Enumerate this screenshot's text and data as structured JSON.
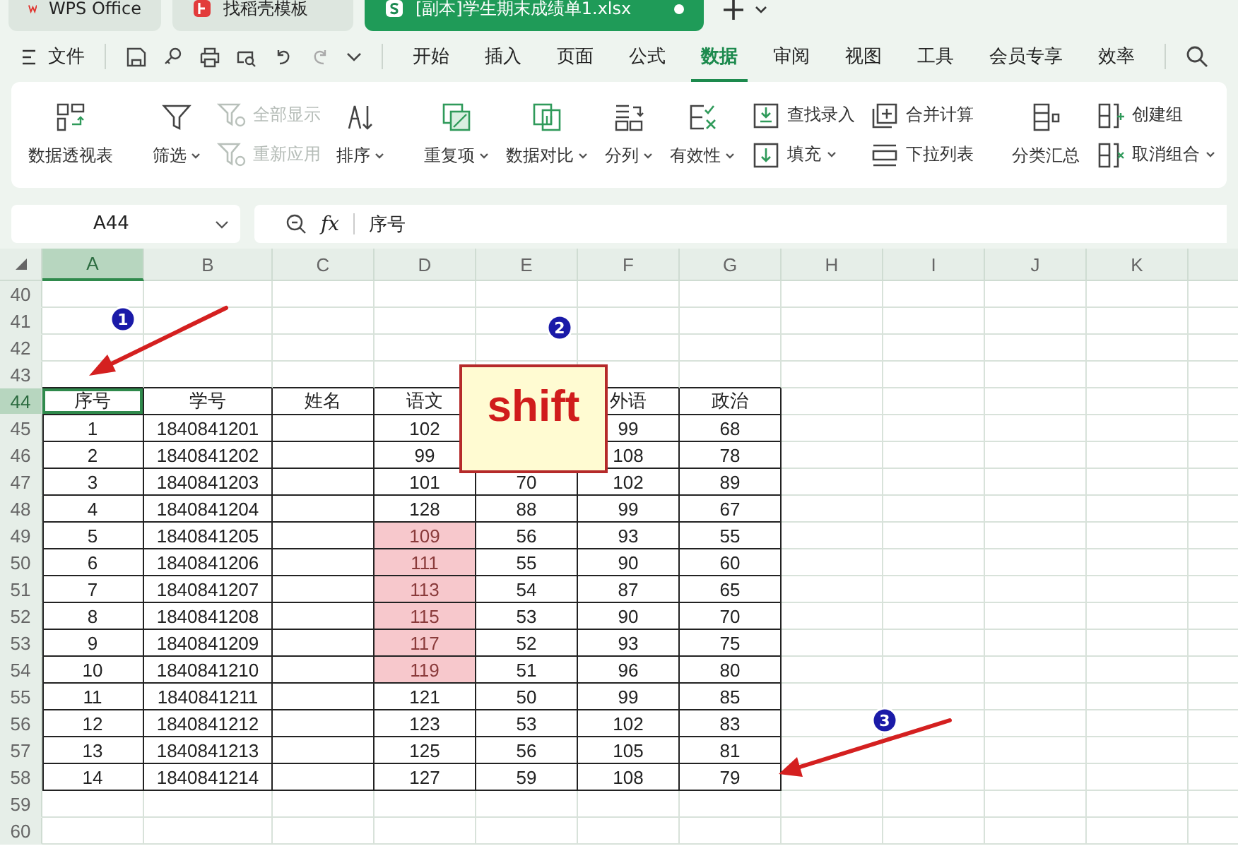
{
  "app_tabs": [
    {
      "label": "WPS Office",
      "kind": "wps",
      "selected": false
    },
    {
      "label": "找稻壳模板",
      "kind": "template",
      "selected": false
    },
    {
      "label": "[副本]学生期末成绩单1.xlsx",
      "kind": "sheet",
      "selected": true,
      "modified": true
    }
  ],
  "menu": {
    "file_label": "文件",
    "tabs": [
      {
        "label": "开始",
        "selected": false
      },
      {
        "label": "插入",
        "selected": false
      },
      {
        "label": "页面",
        "selected": false
      },
      {
        "label": "公式",
        "selected": false
      },
      {
        "label": "数据",
        "selected": true
      },
      {
        "label": "审阅",
        "selected": false
      },
      {
        "label": "视图",
        "selected": false
      },
      {
        "label": "工具",
        "selected": false
      },
      {
        "label": "会员专享",
        "selected": false
      },
      {
        "label": "效率",
        "selected": false
      }
    ]
  },
  "ribbon": [
    [
      {
        "kind": "big",
        "label": "数据透视表",
        "dropdown": false
      }
    ],
    [
      {
        "kind": "big",
        "label": "筛选",
        "dropdown": true
      },
      {
        "kind": "stack",
        "items": [
          {
            "label": "全部显示",
            "disabled": true,
            "dropdown": false
          },
          {
            "label": "重新应用",
            "disabled": true,
            "dropdown": false
          }
        ]
      },
      {
        "kind": "big",
        "label": "排序",
        "dropdown": true
      }
    ],
    [
      {
        "kind": "big",
        "label": "重复项",
        "dropdown": true
      },
      {
        "kind": "big",
        "label": "数据对比",
        "dropdown": true
      },
      {
        "kind": "big",
        "label": "分列",
        "dropdown": true
      },
      {
        "kind": "big",
        "label": "有效性",
        "dropdown": true
      },
      {
        "kind": "stack",
        "items": [
          {
            "label": "查找录入",
            "disabled": false,
            "dropdown": false
          },
          {
            "label": "填充",
            "disabled": false,
            "dropdown": true
          }
        ]
      },
      {
        "kind": "stack",
        "items": [
          {
            "label": "合并计算",
            "disabled": false,
            "dropdown": false
          },
          {
            "label": "下拉列表",
            "disabled": false,
            "dropdown": false
          }
        ]
      }
    ],
    [
      {
        "kind": "big",
        "label": "分类汇总",
        "dropdown": false
      },
      {
        "kind": "stack",
        "items": [
          {
            "label": "创建组",
            "disabled": false,
            "dropdown": false
          },
          {
            "label": "取消组合",
            "disabled": false,
            "dropdown": true
          }
        ]
      }
    ]
  ],
  "name_box": "A44",
  "formula": {
    "function_label": "fx",
    "value": "序号"
  },
  "columns": [
    {
      "label": "A",
      "selected": true
    },
    {
      "label": "B",
      "selected": false
    },
    {
      "label": "C",
      "selected": false
    },
    {
      "label": "D",
      "selected": false
    },
    {
      "label": "E",
      "selected": false
    },
    {
      "label": "F",
      "selected": false
    },
    {
      "label": "G",
      "selected": false
    },
    {
      "label": "H",
      "selected": false
    },
    {
      "label": "I",
      "selected": false
    },
    {
      "label": "J",
      "selected": false
    },
    {
      "label": "K",
      "selected": false
    }
  ],
  "rows": [
    {
      "number": "40",
      "selected": false
    },
    {
      "number": "41",
      "selected": false
    },
    {
      "number": "42",
      "selected": false
    },
    {
      "number": "43",
      "selected": false
    },
    {
      "number": "44",
      "selected": true,
      "cells": [
        {
          "text": "序号",
          "selected": true
        },
        {
          "text": "学号"
        },
        {
          "text": "姓名"
        },
        {
          "text": "语文"
        },
        {},
        {
          "text": "外语"
        },
        {
          "text": "政治"
        }
      ]
    },
    {
      "number": "45",
      "selected": false,
      "cells": [
        {
          "text": "1"
        },
        {
          "text": "1840841201"
        },
        {},
        {
          "text": "102"
        },
        {},
        {
          "text": "99"
        },
        {
          "text": "68"
        }
      ]
    },
    {
      "number": "46",
      "selected": false,
      "cells": [
        {
          "text": "2"
        },
        {
          "text": "1840841202"
        },
        {},
        {
          "text": "99"
        },
        {},
        {
          "text": "108"
        },
        {
          "text": "78"
        }
      ]
    },
    {
      "number": "47",
      "selected": false,
      "cells": [
        {
          "text": "3"
        },
        {
          "text": "1840841203"
        },
        {},
        {
          "text": "101"
        },
        {
          "text": "70"
        },
        {
          "text": "102"
        },
        {
          "text": "89"
        }
      ]
    },
    {
      "number": "48",
      "selected": false,
      "cells": [
        {
          "text": "4"
        },
        {
          "text": "1840841204"
        },
        {},
        {
          "text": "128"
        },
        {
          "text": "88"
        },
        {
          "text": "99"
        },
        {
          "text": "67"
        }
      ]
    },
    {
      "number": "49",
      "selected": false,
      "cells": [
        {
          "text": "5"
        },
        {
          "text": "1840841205"
        },
        {},
        {
          "text": "109",
          "highlighted": true
        },
        {
          "text": "56"
        },
        {
          "text": "93"
        },
        {
          "text": "55"
        }
      ]
    },
    {
      "number": "50",
      "selected": false,
      "cells": [
        {
          "text": "6"
        },
        {
          "text": "1840841206"
        },
        {},
        {
          "text": "111",
          "highlighted": true
        },
        {
          "text": "55"
        },
        {
          "text": "90"
        },
        {
          "text": "60"
        }
      ]
    },
    {
      "number": "51",
      "selected": false,
      "cells": [
        {
          "text": "7"
        },
        {
          "text": "1840841207"
        },
        {},
        {
          "text": "113",
          "highlighted": true
        },
        {
          "text": "54"
        },
        {
          "text": "87"
        },
        {
          "text": "65"
        }
      ]
    },
    {
      "number": "52",
      "selected": false,
      "cells": [
        {
          "text": "8"
        },
        {
          "text": "1840841208"
        },
        {},
        {
          "text": "115",
          "highlighted": true
        },
        {
          "text": "53"
        },
        {
          "text": "90"
        },
        {
          "text": "70"
        }
      ]
    },
    {
      "number": "53",
      "selected": false,
      "cells": [
        {
          "text": "9"
        },
        {
          "text": "1840841209"
        },
        {},
        {
          "text": "117",
          "highlighted": true
        },
        {
          "text": "52"
        },
        {
          "text": "93"
        },
        {
          "text": "75"
        }
      ]
    },
    {
      "number": "54",
      "selected": false,
      "cells": [
        {
          "text": "10"
        },
        {
          "text": "1840841210"
        },
        {},
        {
          "text": "119",
          "highlighted": true
        },
        {
          "text": "51"
        },
        {
          "text": "96"
        },
        {
          "text": "80"
        }
      ]
    },
    {
      "number": "55",
      "selected": false,
      "cells": [
        {
          "text": "11"
        },
        {
          "text": "1840841211"
        },
        {},
        {
          "text": "121"
        },
        {
          "text": "50"
        },
        {
          "text": "99"
        },
        {
          "text": "85"
        }
      ]
    },
    {
      "number": "56",
      "selected": false,
      "cells": [
        {
          "text": "12"
        },
        {
          "text": "1840841212"
        },
        {},
        {
          "text": "123"
        },
        {
          "text": "53"
        },
        {
          "text": "102"
        },
        {
          "text": "83"
        }
      ]
    },
    {
      "number": "57",
      "selected": false,
      "cells": [
        {
          "text": "13"
        },
        {
          "text": "1840841213"
        },
        {},
        {
          "text": "125"
        },
        {
          "text": "56"
        },
        {
          "text": "105"
        },
        {
          "text": "81"
        }
      ]
    },
    {
      "number": "58",
      "selected": false,
      "cells": [
        {
          "text": "14"
        },
        {
          "text": "1840841214"
        },
        {},
        {
          "text": "127"
        },
        {
          "text": "59"
        },
        {
          "text": "108"
        },
        {
          "text": "79"
        }
      ]
    },
    {
      "number": "59",
      "selected": false
    },
    {
      "number": "60",
      "selected": false
    }
  ],
  "annotations": {
    "badges": [
      "1",
      "2",
      "3"
    ],
    "key_label": "shift"
  }
}
